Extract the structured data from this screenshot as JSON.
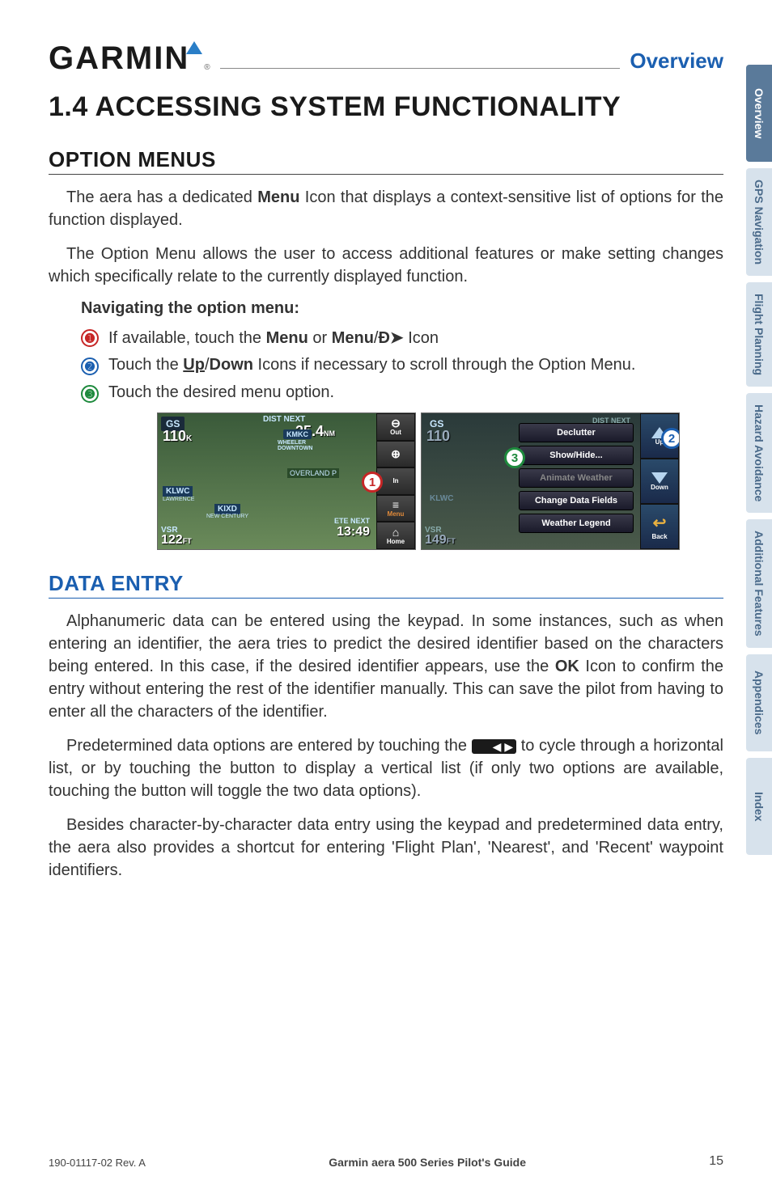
{
  "header": {
    "logo_text": "GARMIN",
    "section_link": "Overview"
  },
  "title": "1.4  ACCESSING SYSTEM FUNCTIONALITY",
  "option_menus": {
    "heading": "OPTION MENUS",
    "para1_pre": "The aera has a dedicated ",
    "para1_bold": "Menu",
    "para1_post": " Icon that displays a context-sensitive list of options for the function displayed.",
    "para2": "The Option Menu allows the user to access additional features or make setting changes which specifically relate to the currently displayed function.",
    "nav_heading": "Navigating the option menu:",
    "steps": [
      {
        "n": "1",
        "pre": "If available, touch the ",
        "b1": "Menu",
        "mid": " or ",
        "b2": "Menu",
        "post_icon": true,
        "tail": " Icon"
      },
      {
        "n": "2",
        "pre": "Touch the ",
        "b1": "Up",
        "sep": "/",
        "b2": "Down",
        "tail": " Icons if necessary to scroll through the Option Menu."
      },
      {
        "n": "3",
        "pre": "Touch the desired menu option."
      }
    ]
  },
  "screenshots": {
    "left": {
      "gs_label": "GS",
      "gs_value": "110",
      "dist_label": "DIST NEXT",
      "dist_value": "25.4",
      "kmkc": "KMKC",
      "kmkc_sub1": "WHEELER",
      "kmkc_sub2": "DOWNTOWN",
      "overland": "OVERLAND P",
      "klwc": "KLWC",
      "klwc_sub": "LAWRENCE",
      "kixd": "KIXD",
      "kixd_sub": "NEW CENTURY",
      "vsr_label": "VSR",
      "vsr_value": "122",
      "ete_label": "ETE NEXT",
      "ete_value": "13:49",
      "side_buttons": [
        "Out",
        "",
        "In",
        "Menu",
        "Home"
      ]
    },
    "right": {
      "gs_label": "GS",
      "gs_value": "110",
      "dist_label": "DIST NEXT",
      "klwc": "KLWC",
      "vsr_label": "VSR",
      "vsr_value": "149",
      "menu_items": [
        "Declutter",
        "Show/Hide...",
        "Animate Weather",
        "Change Data Fields",
        "Weather Legend"
      ],
      "side_buttons": [
        "Up",
        "Down",
        "Back"
      ]
    }
  },
  "data_entry": {
    "heading": "DATA ENTRY",
    "para1_a": "Alphanumeric data can be entered using the keypad.  In some instances, such as when entering an identifier, the aera tries to predict the desired identifier based on the characters being entered.  In this case, if the desired identifier appears, use the ",
    "para1_bold": "OK",
    "para1_b": " Icon to confirm the entry without entering the rest of the identifier manually.  This can save the pilot from having to enter all the characters of the identifier.",
    "para2_a": "Predetermined data options are entered by touching the ",
    "para2_b": " to cycle through a horizontal list, or by touching the button to display a vertical list (if only two options are available, touching the button will toggle the two data options).",
    "para3": "Besides character-by-character data entry using the keypad and predetermined data entry, the aera also provides a shortcut for entering 'Flight Plan', 'Nearest', and 'Recent' waypoint identifiers."
  },
  "side_tabs": [
    "Overview",
    "GPS Navigation",
    "Flight Planning",
    "Hazard Avoidance",
    "Additional Features",
    "Appendices",
    "Index"
  ],
  "footer": {
    "left": "190-01117-02 Rev. A",
    "center": "Garmin aera 500 Series Pilot's Guide",
    "page": "15"
  }
}
